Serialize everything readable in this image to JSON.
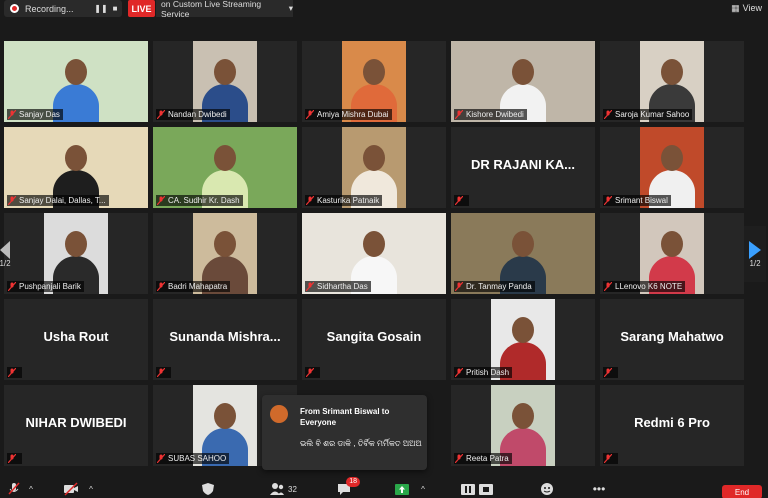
{
  "topbar": {
    "recording_label": "Recording...",
    "live_label": "LIVE",
    "live_service": "on Custom Live Streaming Service",
    "view_label": "View"
  },
  "pagination": {
    "left": "1/2",
    "right": "1/2"
  },
  "tiles": [
    {
      "name": "Sanjay Das",
      "video": true,
      "bg": "#cfe1c4",
      "shirt": "#3a7bd5",
      "style": "full"
    },
    {
      "name": "Nandan Dwibedi",
      "video": true,
      "bg": "#c9c0b2",
      "shirt": "#2b4d8a",
      "style": "narrow"
    },
    {
      "name": "Amiya Mishra Dubai",
      "video": true,
      "bg": "#d98a4a",
      "shirt": "#e06a3a",
      "style": "narrow"
    },
    {
      "name": "Kishore Dwibedi",
      "video": true,
      "bg": "#bfb6a8",
      "shirt": "#f2f2f2",
      "style": "full"
    },
    {
      "name": "Saroja Kumar Sahoo",
      "video": true,
      "bg": "#d8d0c4",
      "shirt": "#3a3a3a",
      "style": "narrow"
    },
    {
      "name": "Sanjay Dalai, Dallas, T...",
      "video": true,
      "bg": "#e6d9b8",
      "shirt": "#1e1e1e",
      "style": "full"
    },
    {
      "name": "CA. Sudhir Kr. Dash",
      "video": true,
      "bg": "#7aa85a",
      "shirt": "#d9e8b0",
      "style": "full",
      "active": true
    },
    {
      "name": "Kasturika Patnaik",
      "video": true,
      "bg": "#b89a70",
      "shirt": "#f0e8dc",
      "style": "narrow"
    },
    {
      "name": "DR RAJANI KA...",
      "video": false
    },
    {
      "name": "Srimant Biswal",
      "video": true,
      "bg": "#c04a2a",
      "shirt": "#f0f0f0",
      "style": "narrow"
    },
    {
      "name": "Pushpanjali Barik",
      "video": true,
      "bg": "#dcdcdc",
      "shirt": "#2a2a2a",
      "style": "narrow"
    },
    {
      "name": "Badri Mahapatra",
      "video": true,
      "bg": "#cdbb9c",
      "shirt": "#6a4a3a",
      "style": "narrow"
    },
    {
      "name": "Sidhartha Das",
      "video": true,
      "bg": "#e8e4dc",
      "shirt": "#f7f7f7",
      "style": "full"
    },
    {
      "name": "Dr. Tanmay Panda",
      "video": true,
      "bg": "#8a7a5a",
      "shirt": "#2a3a4a",
      "style": "full"
    },
    {
      "name": "LLenovo K6 NOTE",
      "video": true,
      "bg": "#d2c7bc",
      "shirt": "#d23a4a",
      "style": "narrow"
    },
    {
      "name": "Usha Rout",
      "video": false
    },
    {
      "name": "Sunanda Mishra...",
      "video": false
    },
    {
      "name": "Sangita Gosain",
      "video": false
    },
    {
      "name": "Pritish Dash",
      "video": true,
      "bg": "#e8e8e8",
      "shirt": "#b02a2a",
      "style": "narrow"
    },
    {
      "name": "Sarang Mahatwo",
      "video": false
    },
    {
      "name": "NIHAR DWIBEDI",
      "video": false
    },
    {
      "name": "SUBAS SAHOO",
      "video": true,
      "bg": "#e4e4e0",
      "shirt": "#3a6ab0",
      "style": "narrow"
    },
    {
      "name": "",
      "video": false,
      "hidden": true
    },
    {
      "name": "Reeta Patra",
      "video": true,
      "bg": "#c8d0c0",
      "shirt": "#c04a6a",
      "style": "narrow"
    },
    {
      "name": "Redmi 6 Pro",
      "video": false
    }
  ],
  "chat": {
    "sender": "From Srimant Biswal to Everyone",
    "message": "ଭଲି ବି ଶର ଡାକି , ତିର୍ବିକ ମର୍ମିକତ ଅଅଅ"
  },
  "toolbar": {
    "participants_count": "32",
    "chat_badge": "18",
    "end_label": "End"
  },
  "colors": {
    "live": "#e02828",
    "active_speaker": "#cfe14a",
    "page_arrow": "#3aa0ff"
  }
}
